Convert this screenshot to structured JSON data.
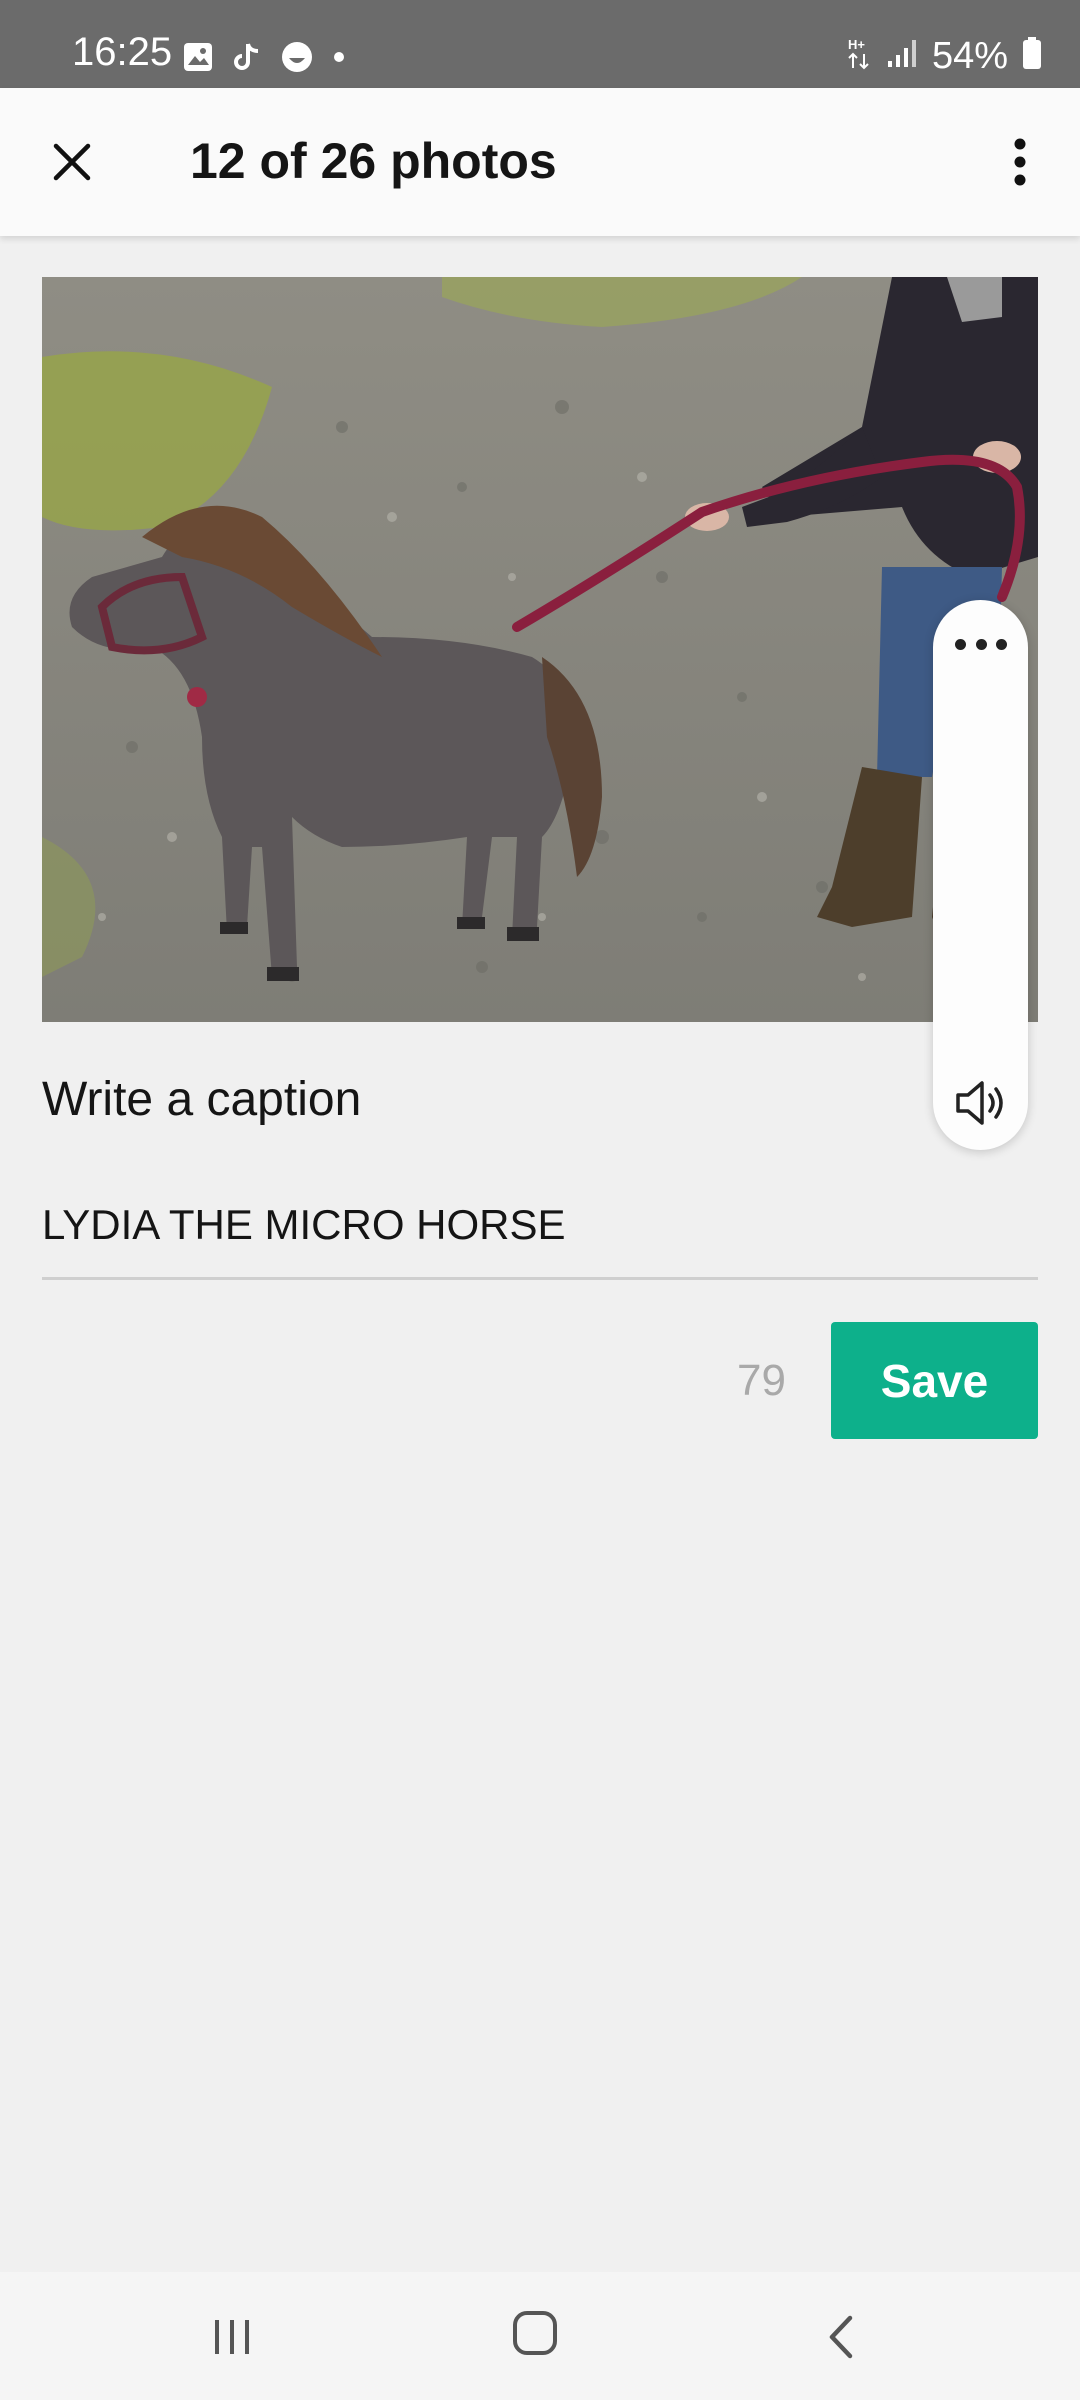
{
  "status_bar": {
    "time": "16:25",
    "network": "H+",
    "battery": "54%",
    "left_icons": [
      "gallery-icon",
      "tiktok-icon",
      "emoji-app-icon",
      "dot-icon"
    ]
  },
  "app_bar": {
    "title": "12 of 26 photos",
    "close_icon": "close-icon",
    "more_icon": "more-vert-icon"
  },
  "caption": {
    "label": "Write a caption",
    "value": "LYDIA THE MICRO HORSE",
    "remaining_chars": "79",
    "save_label": "Save"
  },
  "side_panel": {
    "icons": [
      "more-horiz-icon",
      "volume-icon"
    ]
  },
  "nav_bar": {
    "icons": [
      "recent-apps-icon",
      "home-icon",
      "back-icon"
    ]
  },
  "colors": {
    "accent": "#0db08b",
    "status_bar": "#6b6b6b",
    "background": "#f0f0f0"
  }
}
